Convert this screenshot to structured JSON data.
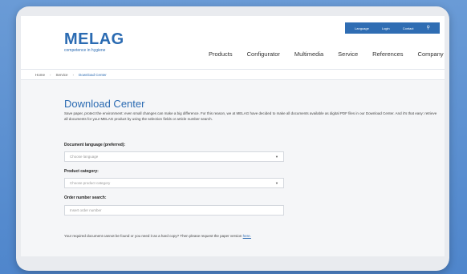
{
  "header": {
    "utility": {
      "language": "Language",
      "login": "Login",
      "contact": "Contact"
    },
    "logo": {
      "brand": "MELAG",
      "tagline": "competence in hygiene"
    },
    "nav": [
      "Products",
      "Configurator",
      "Multimedia",
      "Service",
      "References",
      "Company"
    ]
  },
  "breadcrumb": [
    "Home",
    "Service",
    "Download Center"
  ],
  "main": {
    "title": "Download Center",
    "intro": "Save paper, protect the environment: even small changes can make a big difference. For this reason, we at MELAG have decided to make all documents available as digital PDF files in our Download Center. And it's that easy: retrieve all documents for your MELAG product by using the selection fields or article number search.",
    "language_label": "Document language (preferred):",
    "language_placeholder": "Choose language",
    "category_label": "Product category:",
    "category_placeholder": "Choose product category",
    "order_label": "Order number search:",
    "order_placeholder": "Insert order number",
    "note_text": "Your required document cannot be found or you need it as a hard copy? Then please request the paper version",
    "note_link": "here."
  },
  "colors": {
    "brand": "#2b6bb2",
    "background": "#5a8fd0"
  }
}
